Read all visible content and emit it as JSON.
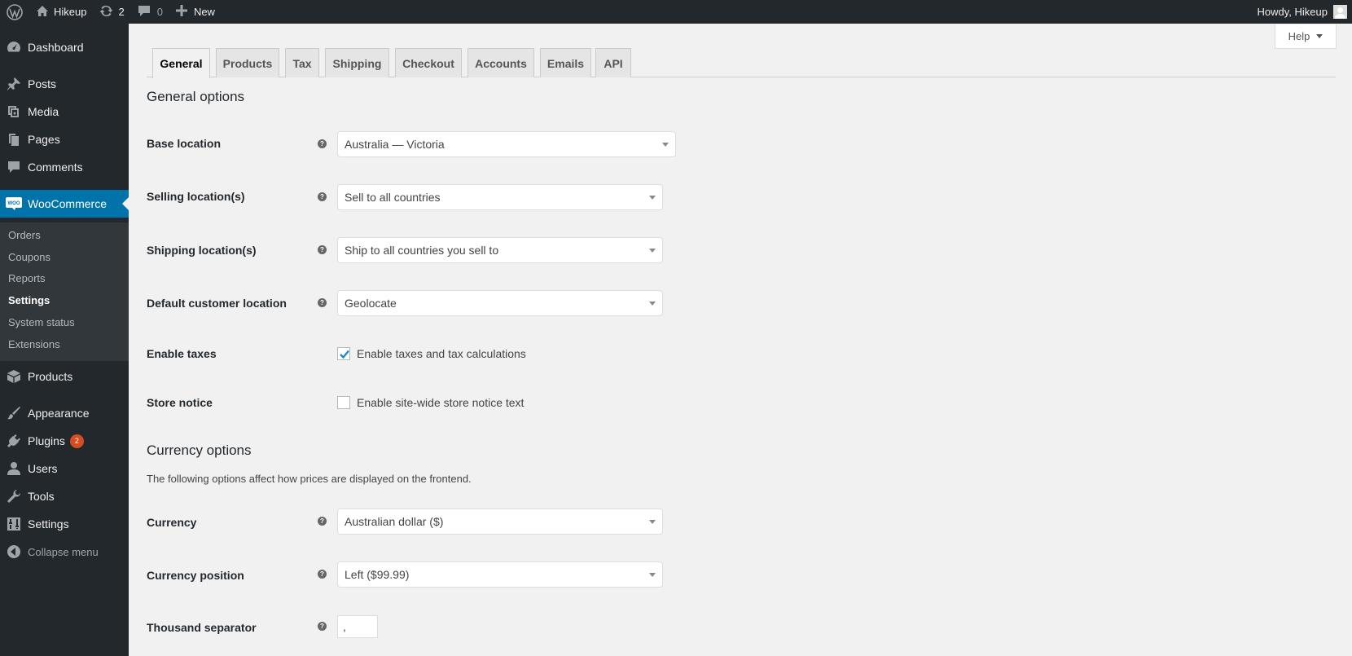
{
  "adminbar": {
    "site_name": "Hikeup",
    "updates_count": "2",
    "comments_count": "0",
    "new_label": "New",
    "howdy": "Howdy, Hikeup"
  },
  "sidebar": {
    "dashboard": "Dashboard",
    "posts": "Posts",
    "media": "Media",
    "pages": "Pages",
    "comments": "Comments",
    "woocommerce": "WooCommerce",
    "submenu": [
      "Orders",
      "Coupons",
      "Reports",
      "Settings",
      "System status",
      "Extensions"
    ],
    "products": "Products",
    "appearance": "Appearance",
    "plugins": "Plugins",
    "plugins_badge": "2",
    "users": "Users",
    "tools": "Tools",
    "settings": "Settings",
    "collapse": "Collapse menu"
  },
  "help": "Help",
  "tabs": [
    "General",
    "Products",
    "Tax",
    "Shipping",
    "Checkout",
    "Accounts",
    "Emails",
    "API"
  ],
  "general": {
    "heading": "General options",
    "base_location_label": "Base location",
    "base_location_value": "Australia — Victoria",
    "selling_label": "Selling location(s)",
    "selling_value": "Sell to all countries",
    "shipping_label": "Shipping location(s)",
    "shipping_value": "Ship to all countries you sell to",
    "default_customer_label": "Default customer location",
    "default_customer_value": "Geolocate",
    "enable_taxes_label": "Enable taxes",
    "enable_taxes_text": "Enable taxes and tax calculations",
    "enable_taxes_checked": true,
    "store_notice_label": "Store notice",
    "store_notice_text": "Enable site-wide store notice text",
    "store_notice_checked": false
  },
  "currency": {
    "heading": "Currency options",
    "description": "The following options affect how prices are displayed on the frontend.",
    "currency_label": "Currency",
    "currency_value": "Australian dollar ($)",
    "position_label": "Currency position",
    "position_value": "Left ($99.99)",
    "thousand_label": "Thousand separator",
    "thousand_value": ","
  },
  "colors": {
    "adminbar": "#23282d",
    "current_menu": "#0073aa",
    "badge": "#d54e21"
  }
}
